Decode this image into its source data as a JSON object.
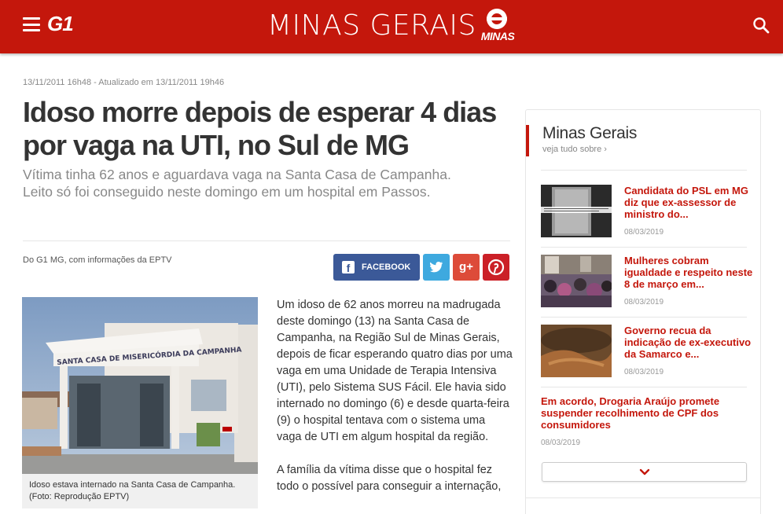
{
  "header": {
    "logo": "G1",
    "region_title": "MINAS GERAIS",
    "globo_word": "MINAS",
    "bg_color": "#c4170c"
  },
  "article": {
    "timestamp": "13/11/2011 16h48 - Atualizado em 13/11/2011 19h46",
    "headline": "Idoso morre depois de esperar 4 dias por vaga na UTI, no Sul de MG",
    "subtitle_line1": "Vítima tinha 62 anos e aguardava vaga na Santa Casa de Campanha.",
    "subtitle_line2": "Leito só foi conseguido neste domingo em um hospital em Passos.",
    "source": "Do G1 MG, com informações da EPTV",
    "photo_sign": "SANTA CASA DE MISERICÓRDIA DA CAMPANHA",
    "caption": "Idoso estava internado na Santa Casa de Campanha. (Foto: Reprodução EPTV)",
    "paragraph1": "Um idoso de 62 anos morreu na madrugada deste domingo (13) na Santa Casa de Campanha, na Região Sul de Minas Gerais, depois de ficar esperando quatro dias por uma vaga em uma Unidade de Terapia Intensiva (UTI), pelo Sistema SUS Fácil. Ele havia sido internado no domingo (6) e desde quarta-feira (9) o hospital tentava com o sistema uma vaga de UTI em algum hospital da região.",
    "paragraph2": "A família da vítima disse que o hospital fez todo o possível para conseguir a internação,"
  },
  "share": {
    "facebook_label": "FACEBOOK",
    "twitter_icon": "twitter-icon",
    "googleplus_label": "g+",
    "pinterest_icon": "pinterest-icon",
    "colors": {
      "facebook": "#3b5998",
      "twitter": "#3ea9df",
      "googleplus": "#dd4b39",
      "pinterest": "#cb2027"
    }
  },
  "sidebar": {
    "title": "Minas Gerais",
    "subtitle": "veja tudo sobre ›",
    "items": [
      {
        "title": "Candidata do PSL em MG diz que ex-assessor de ministro do...",
        "date": "08/03/2019"
      },
      {
        "title": "Mulheres cobram igualdade e respeito neste 8 de março em...",
        "date": "08/03/2019"
      },
      {
        "title": "Governo recua da indicação de ex-executivo da Samarco e...",
        "date": "08/03/2019"
      },
      {
        "title": "Em acordo, Drogaria Araújo promete suspender recolhimento de CPF dos consumidores",
        "date": "08/03/2019"
      }
    ],
    "more_icon": "chevron-down-icon"
  }
}
